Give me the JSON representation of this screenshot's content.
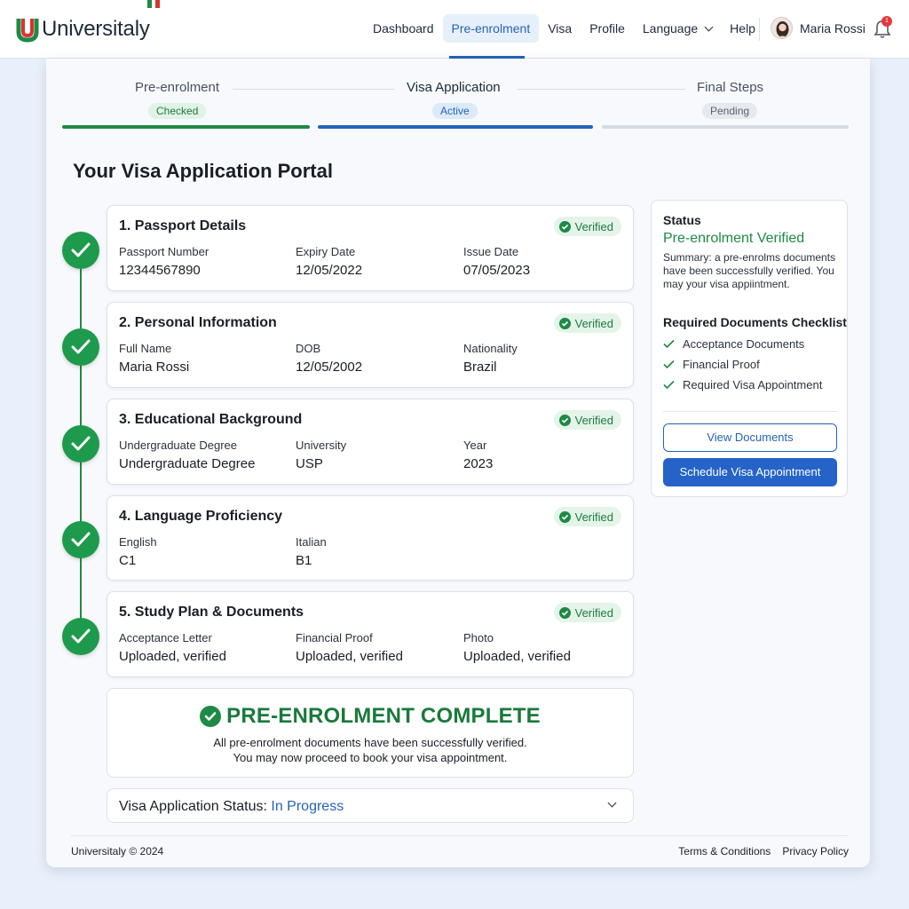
{
  "brand": {
    "name": "Universitaly"
  },
  "nav": {
    "items": [
      "Dashboard",
      "Pre-enrolment",
      "Visa",
      "Profile",
      "Language",
      "Help"
    ],
    "active": "Pre-enrolment"
  },
  "user": {
    "name": "Maria Rossi",
    "notifications": "1"
  },
  "stepper": [
    {
      "label": "Pre-enrolment",
      "state": "Checked"
    },
    {
      "label": "Visa Application",
      "state": "Active"
    },
    {
      "label": "Final Steps",
      "state": "Pending"
    }
  ],
  "page_title": "Your Visa Application Portal",
  "sections": [
    {
      "title": "1. Passport Details",
      "badge": "Verified",
      "fields": [
        {
          "label": "Passport Number",
          "value": "12344567890"
        },
        {
          "label": "Expiry Date",
          "value": "12/05/2022"
        },
        {
          "label": "Issue Date",
          "value": "07/05/2023"
        }
      ]
    },
    {
      "title": "2. Personal Information",
      "badge": "Verified",
      "fields": [
        {
          "label": "Full Name",
          "value": "Maria Rossi"
        },
        {
          "label": "DOB",
          "value": "12/05/2002"
        },
        {
          "label": "Nationality",
          "value": "Brazil"
        }
      ]
    },
    {
      "title": "3. Educational Background",
      "badge": "Verified",
      "fields": [
        {
          "label": "Undergraduate Degree",
          "value": "Undergraduate Degree"
        },
        {
          "label": "University",
          "value": "USP"
        },
        {
          "label": "Year",
          "value": "2023"
        }
      ]
    },
    {
      "title": "4. Language Proficiency",
      "badge": "Verified",
      "fields": [
        {
          "label": "English",
          "value": "C1"
        },
        {
          "label": "Italian",
          "value": "B1"
        }
      ]
    },
    {
      "title": "5. Study Plan & Documents",
      "badge": "Verified",
      "fields": [
        {
          "label": "Acceptance Letter",
          "value": "Uploaded, verified"
        },
        {
          "label": "Financial Proof",
          "value": "Uploaded, verified"
        },
        {
          "label": "Photo",
          "value": "Uploaded, verified"
        }
      ]
    }
  ],
  "complete": {
    "title": "PRE-ENROLMENT COMPLETE",
    "line1": "All pre-enrolment documents have been successfully verified.",
    "line2": "You may now proceed to book your visa appointment."
  },
  "visa_status": {
    "label": "Visa Application Status:",
    "value": "In Progress"
  },
  "side_panel": {
    "status_heading": "Status",
    "status_value": "Pre-enrolment Verified",
    "summary": "Summary: a pre-enrolms documents have been successfully verified. You may your visa appiintment.",
    "checklist_heading": "Required Documents Checklist",
    "checklist": [
      "Acceptance Documents",
      "Financial Proof",
      "Required Visa Appointment"
    ],
    "view_button": "View Documents",
    "schedule_button": "Schedule Visa Appointment"
  },
  "footer": {
    "copyright": "Universitaly © 2024",
    "links": [
      "Terms & Conditions",
      "Privacy Policy"
    ]
  },
  "colors": {
    "accent": "#2563b8",
    "success": "#1e8a45",
    "pending": "#d5dbe4"
  }
}
